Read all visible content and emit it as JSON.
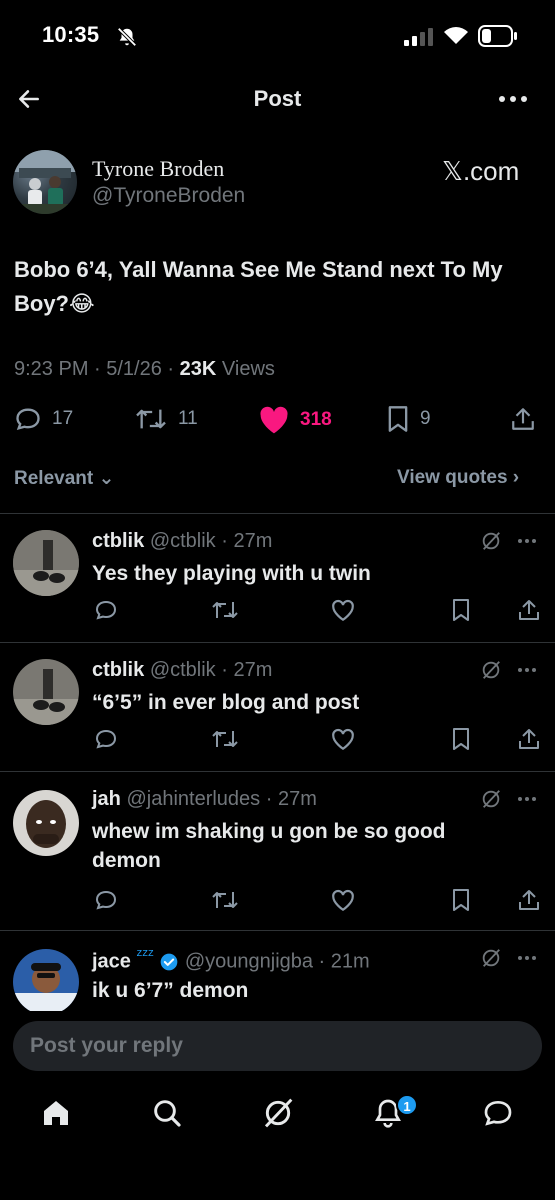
{
  "status_bar": {
    "time": "10:35"
  },
  "header": {
    "title": "Post"
  },
  "author": {
    "name": "Tyrone Broden",
    "handle": "@TyroneBroden",
    "source": "𝕏.com"
  },
  "tweet": {
    "text": "Bobo 6’4, Yall Wanna See Me Stand next To My Boy?😂",
    "time": "9:23 PM · 5/1/26 · ",
    "views_count": "23K",
    "views_label": " Views"
  },
  "actions": {
    "replies": "17",
    "reposts": "11",
    "likes": "318",
    "bookmarks": "9"
  },
  "filter": {
    "label": "Relevant ⌄",
    "quotes": "View quotes ›"
  },
  "replies": [
    {
      "name": "ctblik",
      "handle": "@ctblik · 27m",
      "text": "Yes they playing with u twin"
    },
    {
      "name": "ctblik",
      "handle": "@ctblik · 27m",
      "text": "“6’5” in ever blog and post"
    },
    {
      "name": "jah",
      "handle": "@jahinterludes · 27m",
      "text": "whew im shaking u gon be so good demon"
    },
    {
      "name": "jace",
      "emoji": "ᶻᶻᶻ",
      "handle": "@youngnjigba · 21m",
      "text": "ik u 6’7” demon"
    }
  ],
  "composer": {
    "placeholder": "Post your reply"
  },
  "nav": {
    "notification_count": "1"
  },
  "colors": {
    "background": "#000000",
    "like": "#f91880",
    "verified": "#1d9bf0",
    "muted": "#71767b"
  }
}
